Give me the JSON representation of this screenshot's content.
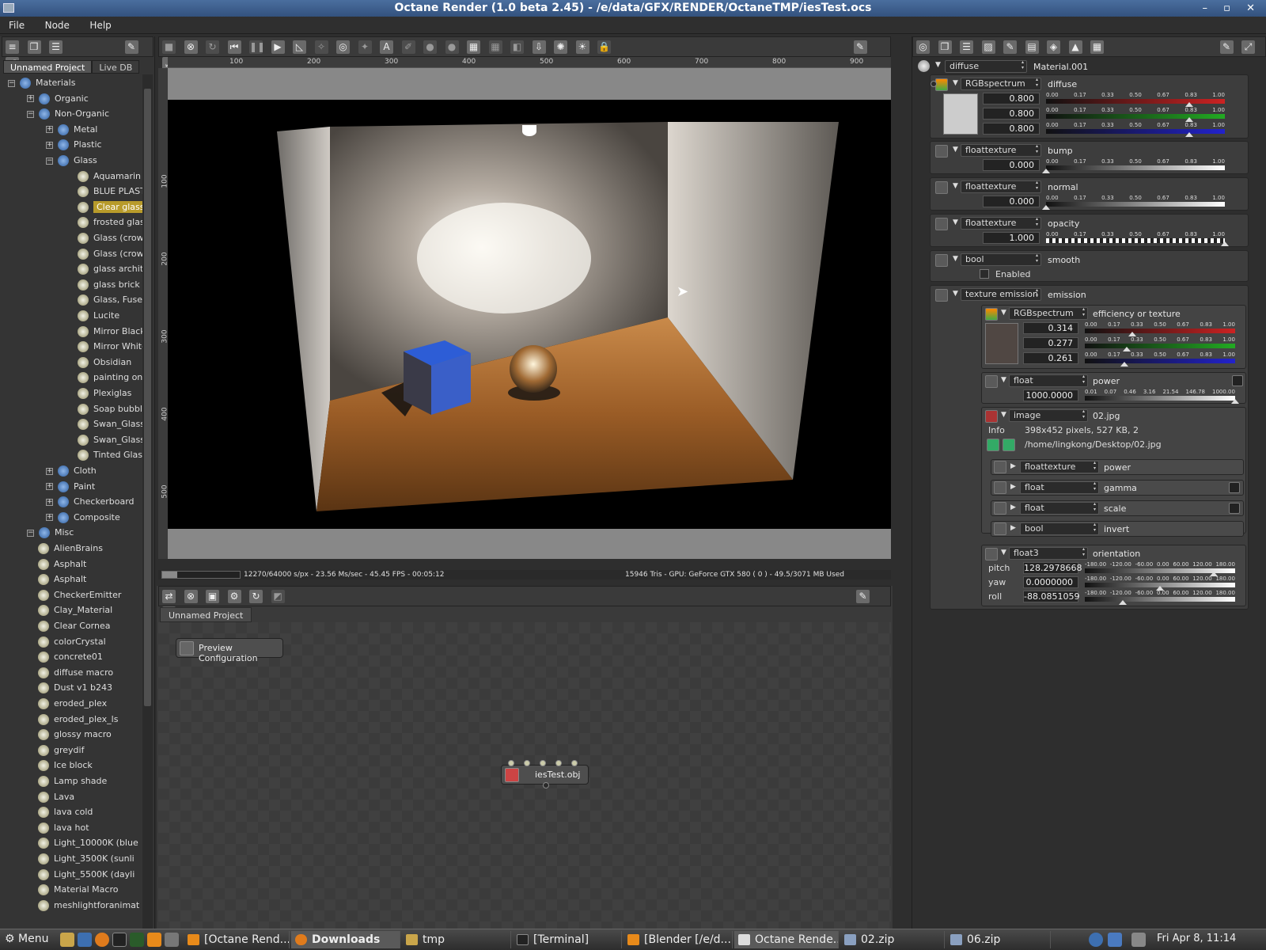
{
  "window": {
    "title": "Octane Render (1.0 beta 2.45) - /e/data/GFX/RENDER/OctaneTMP/iesTest.ocs",
    "controls": "– ▫ ✕"
  },
  "menu": [
    "File",
    "Node",
    "Help"
  ],
  "left_tabs": [
    "Unnamed Project",
    "Live DB"
  ],
  "tree": [
    {
      "label": "Materials",
      "level": 0,
      "exp": "−"
    },
    {
      "label": "Organic",
      "level": 1,
      "exp": "+"
    },
    {
      "label": "Non-Organic",
      "level": 1,
      "exp": "−"
    },
    {
      "label": "Metal",
      "level": 2,
      "exp": "+"
    },
    {
      "label": "Plastic",
      "level": 2,
      "exp": "+"
    },
    {
      "label": "Glass",
      "level": 2,
      "exp": "−"
    },
    {
      "label": "Aquamarin ro",
      "level": 3
    },
    {
      "label": "BLUE PLAST",
      "level": 3
    },
    {
      "label": "Clear glass",
      "level": 3,
      "selected": true
    },
    {
      "label": "frosted glass",
      "level": 3
    },
    {
      "label": "Glass (crown",
      "level": 3
    },
    {
      "label": "Glass (crown",
      "level": 3
    },
    {
      "label": "glass architec",
      "level": 3
    },
    {
      "label": "glass brick",
      "level": 3
    },
    {
      "label": "Glass, Fused",
      "level": 3
    },
    {
      "label": "Lucite",
      "level": 3
    },
    {
      "label": "Mirror Black",
      "level": 3
    },
    {
      "label": "Mirror White",
      "level": 3
    },
    {
      "label": "Obsidian",
      "level": 3
    },
    {
      "label": "painting on gl",
      "level": 3
    },
    {
      "label": "Plexiglas",
      "level": 3
    },
    {
      "label": "Soap bubble",
      "level": 3
    },
    {
      "label": "Swan_Glass",
      "level": 3
    },
    {
      "label": "Swan_Glass",
      "level": 3
    },
    {
      "label": "Tinted Glass",
      "level": 3
    },
    {
      "label": "Cloth",
      "level": 2,
      "exp": "+"
    },
    {
      "label": "Paint",
      "level": 2,
      "exp": "+"
    },
    {
      "label": "Checkerboard",
      "level": 2,
      "exp": "+"
    },
    {
      "label": "Composite",
      "level": 2,
      "exp": "+"
    },
    {
      "label": "Misc",
      "level": 1,
      "exp": "−"
    },
    {
      "label": "AlienBrains",
      "level": 2
    },
    {
      "label": "Asphalt",
      "level": 2
    },
    {
      "label": "Asphalt",
      "level": 2
    },
    {
      "label": "CheckerEmitter",
      "level": 2
    },
    {
      "label": "Clay_Material",
      "level": 2
    },
    {
      "label": "Clear Cornea",
      "level": 2
    },
    {
      "label": "colorCrystal",
      "level": 2
    },
    {
      "label": "concrete01",
      "level": 2
    },
    {
      "label": "diffuse macro",
      "level": 2
    },
    {
      "label": "Dust v1 b243",
      "level": 2
    },
    {
      "label": "eroded_plex",
      "level": 2
    },
    {
      "label": "eroded_plex_ls",
      "level": 2
    },
    {
      "label": "glossy macro",
      "level": 2
    },
    {
      "label": "greydif",
      "level": 2
    },
    {
      "label": "Ice block",
      "level": 2
    },
    {
      "label": "Lamp shade",
      "level": 2
    },
    {
      "label": "Lava",
      "level": 2
    },
    {
      "label": "lava cold",
      "level": 2
    },
    {
      "label": "lava hot",
      "level": 2
    },
    {
      "label": "Light_10000K (blue",
      "level": 2
    },
    {
      "label": "Light_3500K (sunli",
      "level": 2
    },
    {
      "label": "Light_5500K (dayli",
      "level": 2
    },
    {
      "label": "Material Macro",
      "level": 2
    },
    {
      "label": "meshlightforanimat",
      "level": 2
    }
  ],
  "ruler": {
    "top": [
      "100",
      "200",
      "300",
      "400",
      "500",
      "600",
      "700",
      "800",
      "900"
    ],
    "left": [
      "100",
      "200",
      "300",
      "400",
      "500"
    ]
  },
  "viewport": {
    "status_left": "12270/64000 s/px - 23.56 Ms/sec - 45.45 FPS - 00:05:12",
    "status_right": "15946 Tris - GPU: GeForce GTX 580 ( 0 ) - 49.5/3071 MB Used",
    "progress_fraction": 0.19
  },
  "node_editor": {
    "tab": "Unnamed Project",
    "preview_node": "Preview Configuration",
    "mesh_node": "iesTest.obj"
  },
  "material": {
    "type": "diffuse",
    "name": "Material.001",
    "diffuse": {
      "type": "RGBspectrum",
      "label": "diffuse",
      "r": "0.800",
      "g": "0.800",
      "b": "0.800",
      "swatch": "#cccccc"
    },
    "bump": {
      "type": "floattexture",
      "label": "bump",
      "value": "0.000"
    },
    "normal": {
      "type": "floattexture",
      "label": "normal",
      "value": "0.000"
    },
    "opacity": {
      "type": "floattexture",
      "label": "opacity",
      "value": "1.000"
    },
    "smooth": {
      "type": "bool",
      "label": "smooth",
      "checkbox": "Enabled"
    },
    "emission": {
      "type": "texture emission",
      "label": "emission",
      "eff": {
        "type": "RGBspectrum",
        "label": "efficiency or texture",
        "r": "0.314",
        "g": "0.277",
        "b": "0.261",
        "swatch": "#504743"
      },
      "power": {
        "type": "float",
        "label": "power",
        "value": "1000.0000"
      },
      "image": {
        "type": "image",
        "label": "02.jpg",
        "info_label": "Info",
        "info": "398x452 pixels, 527 KB, 2",
        "path": "/home/lingkong/Desktop/02.jpg"
      },
      "sub": [
        {
          "type": "floattexture",
          "label": "power"
        },
        {
          "type": "float",
          "label": "gamma"
        },
        {
          "type": "float",
          "label": "scale"
        },
        {
          "type": "bool",
          "label": "invert"
        }
      ],
      "orientation": {
        "type": "float3",
        "label": "orientation",
        "pitch_label": "pitch",
        "pitch": "128.2978668",
        "yaw_label": "yaw",
        "yaw": "0.0000000",
        "roll_label": "roll",
        "roll": "-88.0851059"
      }
    }
  },
  "slider_ticks": [
    "0.00",
    "0.17",
    "0.33",
    "0.50",
    "0.67",
    "0.83",
    "1.00"
  ],
  "power_ticks": [
    "0.01",
    "0.07",
    "0.46",
    "3.16",
    "21.54",
    "146.78",
    "1000.00"
  ],
  "angle_ticks": [
    "-180.00",
    "-120.00",
    "-60.00",
    "0.00",
    "60.00",
    "120.00",
    "180.00"
  ],
  "taskbar": {
    "menu": "Menu",
    "tasks": [
      "[Octane Rend...",
      "Downloads",
      "tmp",
      "[Terminal]",
      "[Blender [/e/d...",
      "Octane Rende...",
      "02.zip",
      "06.zip"
    ],
    "clock": "Fri Apr 8, 11:14"
  }
}
